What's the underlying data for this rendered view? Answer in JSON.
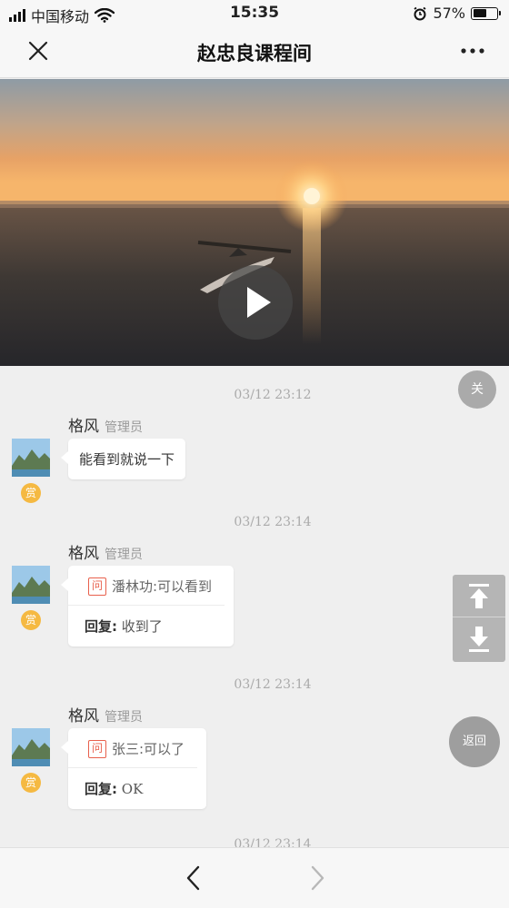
{
  "status_bar": {
    "carrier": "中国移动",
    "time": "15:35",
    "battery_percent": "57%",
    "battery_level": 0.57,
    "icons": [
      "signal-icon",
      "wifi-icon",
      "alarm-icon",
      "battery-icon"
    ]
  },
  "nav": {
    "title": "赵忠良课程间",
    "close_icon": "close-icon",
    "more_icon": "more-icon"
  },
  "video": {
    "play_icon": "play-icon"
  },
  "chat": {
    "timestamps": [
      "03/12 23:12",
      "03/12 23:14",
      "03/12 23:14",
      "03/12 23:14"
    ],
    "messages": [
      {
        "sender": "格风",
        "role": "管理员",
        "reward_label": "赏",
        "text": "能看到就说一下"
      },
      {
        "sender": "格风",
        "role": "管理员",
        "reward_label": "赏",
        "ask_label": "问",
        "quote": "潘林功:可以看到",
        "reply_label": "回复:",
        "reply": "收到了"
      },
      {
        "sender": "格风",
        "role": "管理员",
        "reward_label": "赏",
        "ask_label": "问",
        "quote": "张三:可以了",
        "reply_label": "回复:",
        "reply": "OK"
      }
    ]
  },
  "floating": {
    "close_label": "关",
    "back_label": "返回",
    "scroll_top_icon": "arrow-to-top-icon",
    "scroll_bottom_icon": "arrow-to-bottom-icon"
  },
  "toolbar": {
    "back_icon": "chevron-left-icon",
    "forward_icon": "chevron-right-icon"
  },
  "colors": {
    "accent_reward": "#f5b942",
    "ask_icon": "#e8604c",
    "background": "#efefef"
  }
}
